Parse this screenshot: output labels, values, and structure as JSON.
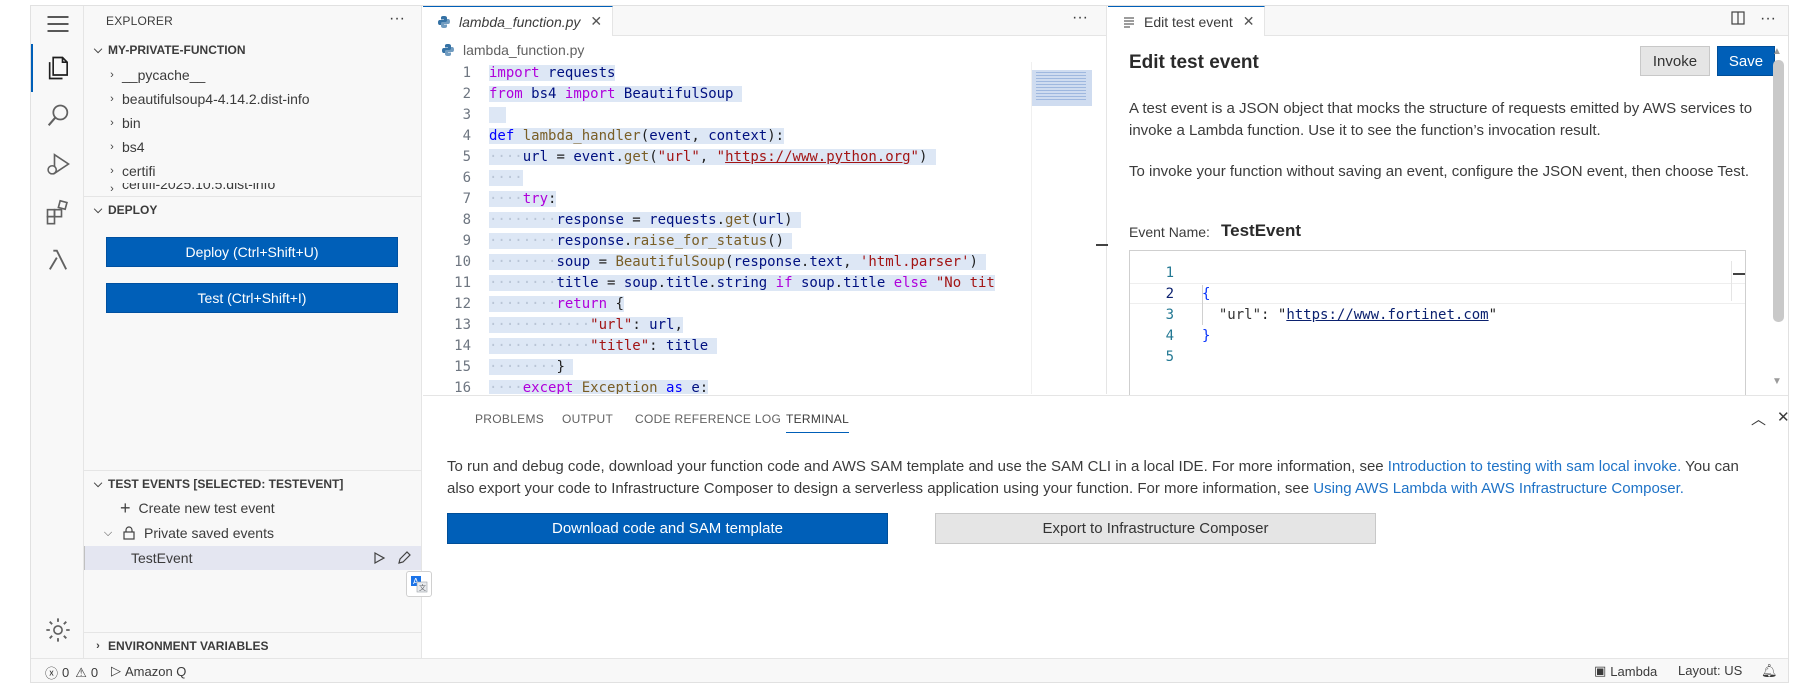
{
  "sidebar": {
    "header": "EXPLORER",
    "folder": "MY-PRIVATE-FUNCTION",
    "files": [
      "__pycache__",
      "beautifulsoup4-4.14.2.dist-info",
      "bin",
      "bs4",
      "certifi",
      "certifi-2025.10.5.dist-info"
    ],
    "deploy_section": "DEPLOY",
    "deploy_label": "Deploy (Ctrl+Shift+U)",
    "test_label": "Test (Ctrl+Shift+I)",
    "test_events_section": "TEST EVENTS [SELECTED: TESTEVENT]",
    "create_event": "Create new test event",
    "private_saved": "Private saved events",
    "selected_event": "TestEvent",
    "env_section": "ENVIRONMENT VARIABLES"
  },
  "editor": {
    "tab_label": "lambda_function.py",
    "breadcrumb": "lambda_function.py",
    "line_numbers": [
      "1",
      "2",
      "3",
      "4",
      "5",
      "6",
      "7",
      "8",
      "9",
      "10",
      "11",
      "12",
      "13",
      "14",
      "15",
      "16"
    ]
  },
  "test_panel": {
    "tab_label": "Edit test event",
    "title": "Edit test event",
    "invoke_label": "Invoke",
    "save_label": "Save",
    "description": "A test event is a JSON object that mocks the structure of requests emitted by AWS services to invoke a Lambda function. Use it to see the function’s invocation result.",
    "instruction": "To invoke your function without saving an event, configure the JSON event, then choose Test.",
    "event_name_label": "Event Name:",
    "event_name": "TestEvent",
    "json_line_numbers": [
      "1",
      "2",
      "3",
      "4",
      "5"
    ],
    "json_key": "\"url\"",
    "json_value": "https://www.fortinet.com"
  },
  "bottom_panel": {
    "tabs": [
      "PROBLEMS",
      "OUTPUT",
      "CODE REFERENCE LOG",
      "TERMINAL"
    ],
    "active_tab": "TERMINAL",
    "text_1": "To run and debug code, download your function code and AWS SAM template and use the SAM CLI in a local IDE. For more information, see ",
    "link_1": "Introduction to testing with sam local invoke.",
    "text_2": " You can also export your code to Infrastructure Composer to design a serverless application using your function. For more information, see ",
    "link_2": "Using AWS Lambda with AWS Infrastructure Composer.",
    "download_label": "Download code and SAM template",
    "export_label": "Export to Infrastructure Composer"
  },
  "statusbar": {
    "errors": "0",
    "warnings": "0",
    "amazon_q": "Amazon Q",
    "lambda": "Lambda",
    "layout": "Layout: US"
  },
  "colors": {
    "accent": "#005fb8",
    "link": "#1f73c7",
    "selection": "#dde7f5"
  }
}
